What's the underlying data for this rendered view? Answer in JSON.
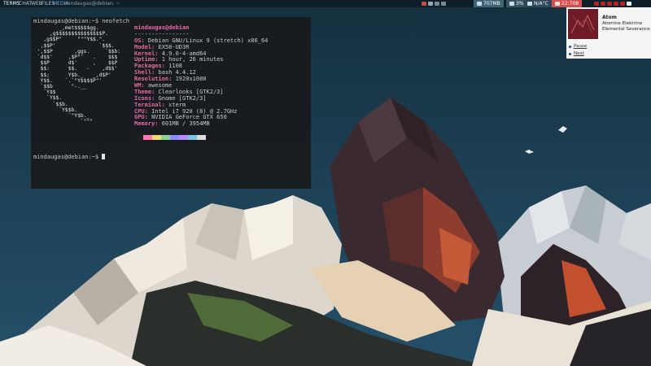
{
  "topbar": {
    "tags": [
      {
        "label": "TERMS",
        "active": true
      },
      {
        "label": "CHAT",
        "active": false
      },
      {
        "label": "WEB",
        "active": false
      },
      {
        "label": "FILES",
        "active": false
      },
      {
        "label": "MEDIA",
        "active": false
      }
    ],
    "window_title": "mindaugas@debian: ~",
    "memory_text": "707MB",
    "cpu_text": "3%",
    "temp_text": "N/A°C",
    "clock_text": "22:708",
    "colors": {
      "bar_bg": "#0f1f29",
      "memory": "#6a8da0",
      "cpu": "#6a8da0",
      "temp": "#6a8da0",
      "clock": "#e35b5b"
    }
  },
  "terminal": {
    "command_line": "mindaugas@debian:~$ neofetch",
    "logo_lines": [
      "        _,met$$$$$gg.",
      "     ,g$$$$$$$$$$$$$$$P.",
      "   ,g$$P\"     \"\"\"Y$$.\".",
      "  ,$$P'              `$$$.",
      " ',$$P       ,ggs.     `$$b:",
      " `d$$'     ,$P\"'   .    $$$",
      "  $$P      d$'     ,    $$P",
      "  $$:      $$.   -    ,d$$'",
      "  $$;      Y$b._   _,d$P'",
      "  Y$$.    `.`\"Y$$$$P\"'",
      "  `$$b      \"-.__",
      "   `Y$$",
      "    `Y$$.",
      "      `$$b.",
      "        `Y$$b.",
      "           `\"Y$b._",
      "               `\"\"\""
    ],
    "host": "mindaugas@debian",
    "separator": "----------------",
    "info": [
      {
        "label": "OS",
        "value": "Debian GNU/Linux 9 (stretch) x86_64"
      },
      {
        "label": "Model",
        "value": "EX58-UD3R"
      },
      {
        "label": "Kernel",
        "value": "4.9.0-4-amd64"
      },
      {
        "label": "Uptime",
        "value": "1 hour, 26 minutes"
      },
      {
        "label": "Packages",
        "value": "1108"
      },
      {
        "label": "Shell",
        "value": "bash 4.4.12"
      },
      {
        "label": "Resolution",
        "value": "1920x1080"
      },
      {
        "label": "WM",
        "value": "awesome"
      },
      {
        "label": "Theme",
        "value": "Clearlooks [GTK2/3]"
      },
      {
        "label": "Icons",
        "value": "Gnome [GTK2/3]"
      },
      {
        "label": "Terminal",
        "value": "xterm"
      },
      {
        "label": "CPU",
        "value": "Intel i7 920 (8) @ 2.7GHz"
      },
      {
        "label": "GPU",
        "value": "NVIDIA GeForce GTX 650"
      },
      {
        "label": "Memory",
        "value": "601MB / 3954MB"
      }
    ],
    "swatches": [
      "#1d1f21",
      "#ff78b4",
      "#f0dc6e",
      "#8cd28c",
      "#8c8cff",
      "#b48cff",
      "#78c8e6",
      "#dcdcdc"
    ],
    "prompt": "mindaugas@debian:~$"
  },
  "music": {
    "title": "Atom",
    "artist": "Atomine Elektrine",
    "album": "Elemental Severance",
    "pause_label": "Pause",
    "next_label": "Next"
  }
}
